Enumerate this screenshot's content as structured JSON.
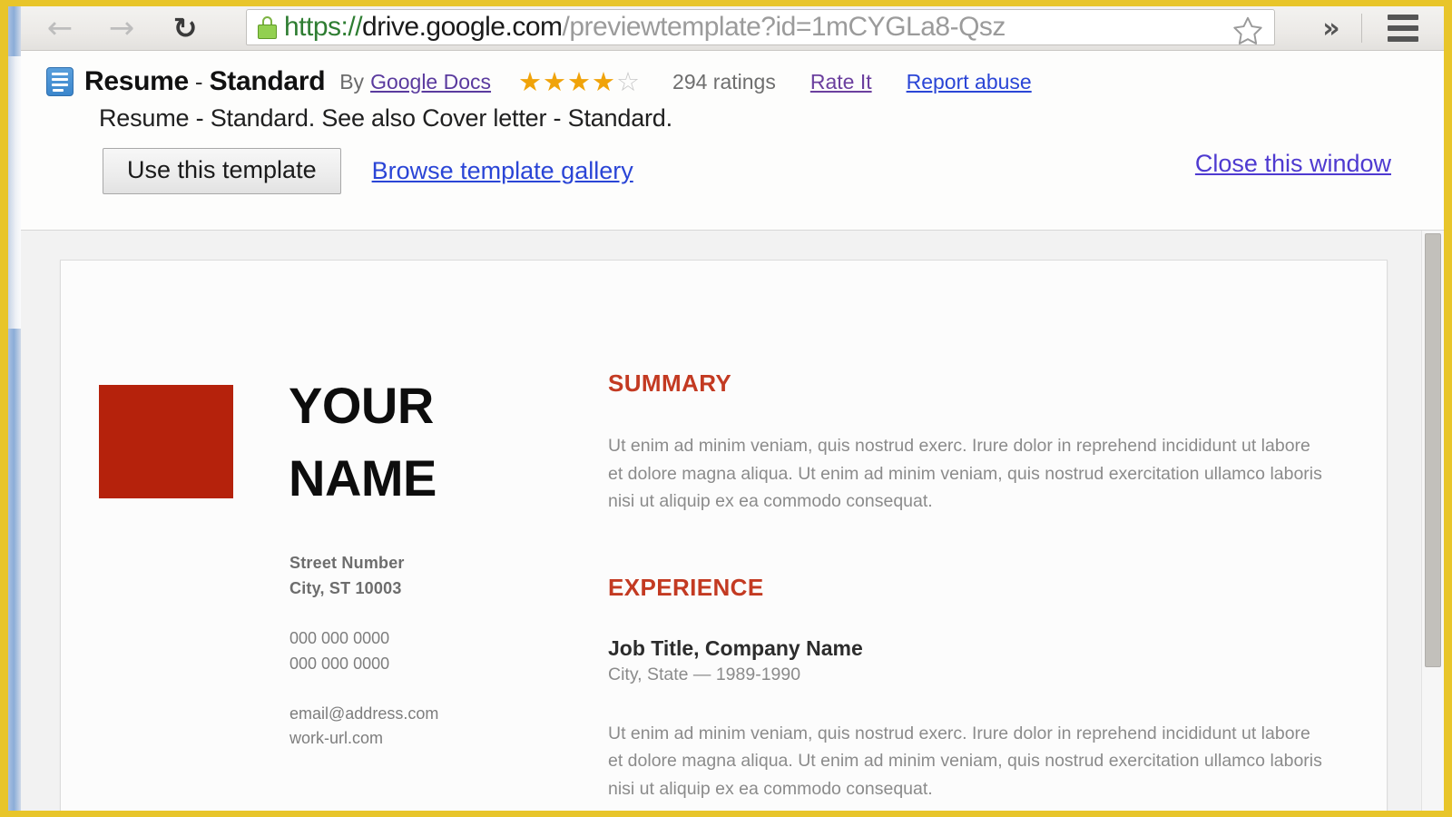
{
  "browser": {
    "back_icon": "back-arrow-icon",
    "forward_icon": "forward-arrow-icon",
    "reload_icon": "reload-icon",
    "lock_icon": "lock-icon",
    "url_scheme": "https://",
    "url_host": "drive.google.com",
    "url_path": "/previewtemplate?id=1mCYGLa8-Qsz",
    "url_full": "https://drive.google.com/previewtemplate?id=1mCYGLa8-Qsz",
    "star_icon": "star-outline-icon",
    "overflow_label": "»",
    "menu_icon": "hamburger-menu-icon"
  },
  "template": {
    "doc_icon": "google-doc-icon",
    "name": "Resume",
    "separator": "-",
    "variant": "Standard",
    "by_label": "By",
    "author": "Google Docs",
    "rating_stars_filled": 4,
    "rating_stars_total": 5,
    "rating_count_label": "294 ratings",
    "rate_it_label": "Rate It",
    "report_abuse_label": "Report abuse",
    "description": "Resume - Standard. See also Cover letter - Standard.",
    "use_template_label": "Use this template",
    "browse_gallery_label": "Browse template gallery",
    "close_window_label": "Close this window",
    "accent_link_color": "#2a45d6",
    "visited_link_color": "#6b3f9e",
    "star_color": "#f0a30a"
  },
  "resume": {
    "photo_color": "#b5220c",
    "name_line1": "YOUR",
    "name_line2": "NAME",
    "address_line1": "Street Number",
    "address_line2": "City, ST 10003",
    "phone1": "000 000 0000",
    "phone2": "000 000 0000",
    "email": "email@address.com",
    "website": "work-url.com",
    "watermark": "",
    "summary_heading": "SUMMARY",
    "summary_text": "Ut enim ad minim veniam, quis nostrud exerc. Irure dolor in reprehend incididunt ut labore et dolore magna aliqua. Ut enim ad minim veniam, quis nostrud exercitation ullamco laboris nisi ut aliquip ex ea commodo consequat.",
    "experience_heading": "EXPERIENCE",
    "job_title": "Job Title, Company Name",
    "job_meta": "City, State — 1989-1990",
    "job_text": "Ut enim ad minim veniam, quis nostrud exerc. Irure dolor in reprehend incididunt ut labore et dolore magna aliqua. Ut enim ad minim veniam, quis nostrud exercitation ullamco laboris nisi ut aliquip ex ea commodo consequat.",
    "heading_color": "#c33a22"
  }
}
